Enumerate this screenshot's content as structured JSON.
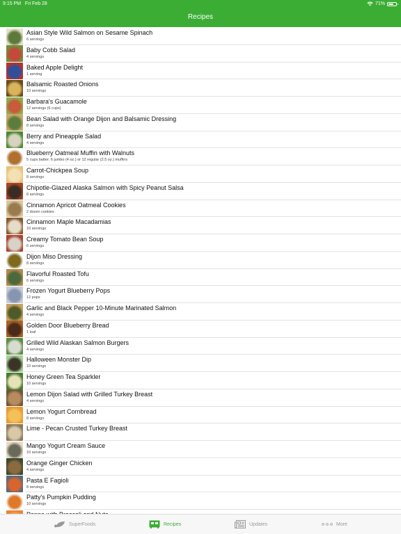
{
  "status_bar": {
    "time": "9:15 PM",
    "date": "Fri Feb 28",
    "battery_percent": "71%",
    "battery_level": 0.71,
    "wifi_icon": "wifi-icon"
  },
  "header": {
    "title": "Recipes"
  },
  "recipes": [
    {
      "name": "Asian Style Wild Salmon on Sesame Spinach",
      "servings": "6 servings",
      "thumb_colors": [
        "#e8e0cf",
        "#5d7a3a"
      ]
    },
    {
      "name": "Baby Cobb Salad",
      "servings": "4 servings",
      "thumb_colors": [
        "#6f8f3c",
        "#c34a3a"
      ]
    },
    {
      "name": "Baked Apple Delight",
      "servings": "1 serving",
      "thumb_colors": [
        "#b8322d",
        "#2f4f9a"
      ]
    },
    {
      "name": "Balsamic Roasted Onions",
      "servings": "10 servings",
      "thumb_colors": [
        "#6b4a1c",
        "#d8b45a"
      ]
    },
    {
      "name": "Barbara's Guacamole",
      "servings": "12 servings (6 cups)",
      "thumb_colors": [
        "#8ab04a",
        "#c95a3a"
      ]
    },
    {
      "name": "Bean Salad with Orange Dijon and Balsamic Dressing",
      "servings": "8 servings",
      "thumb_colors": [
        "#c9a86a",
        "#5b7d3b"
      ]
    },
    {
      "name": "Berry and Pineapple Salad",
      "servings": "4 servings",
      "thumb_colors": [
        "#4d8a2f",
        "#d8d2c0"
      ]
    },
    {
      "name": "Blueberry Oatmeal Muffin with Walnuts",
      "servings": "5 cups batter; 6 jumbo (4 oz.) or 12 regular (2.5 oz.) muffins",
      "thumb_colors": [
        "#ffffff",
        "#b0702e"
      ]
    },
    {
      "name": "Carrot-Chickpea Soup",
      "servings": "8 servings",
      "thumb_colors": [
        "#e9c27a",
        "#f3e0b5"
      ]
    },
    {
      "name": "Chipotle-Glazed Alaska Salmon with Spicy Peanut Salsa",
      "servings": "8 servings",
      "thumb_colors": [
        "#a5442a",
        "#3a2c22"
      ]
    },
    {
      "name": "Cinnamon Apricot Oatmeal Cookies",
      "servings": "2 dozen cookies",
      "thumb_colors": [
        "#d8c7a0",
        "#9a7a4e"
      ]
    },
    {
      "name": "Cinnamon Maple Macadamias",
      "servings": "10 servings",
      "thumb_colors": [
        "#8a5a2e",
        "#e6dcc8"
      ]
    },
    {
      "name": "Creamy Tomato Bean Soup",
      "servings": "6 servings",
      "thumb_colors": [
        "#a9442e",
        "#d9d2c6"
      ]
    },
    {
      "name": "Dijon Miso Dressing",
      "servings": "8 servings",
      "thumb_colors": [
        "#ffffff",
        "#7d6a1e"
      ]
    },
    {
      "name": "Flavorful Roasted Tofu",
      "servings": "6 servings",
      "thumb_colors": [
        "#b4874e",
        "#4a6a3a"
      ]
    },
    {
      "name": "Frozen Yogurt Blueberry Pops",
      "servings": "12 pops",
      "thumb_colors": [
        "#c7ced8",
        "#8696b0"
      ]
    },
    {
      "name": "Garlic and Black Pepper 10-Minute Marinated Salmon",
      "servings": "4 servings",
      "thumb_colors": [
        "#c8a060",
        "#4e5a2a"
      ]
    },
    {
      "name": "Golden Door Blueberry Bread",
      "servings": "1 loaf",
      "thumb_colors": [
        "#a8642a",
        "#4a2a18"
      ]
    },
    {
      "name": "Grilled Wild Alaskan Salmon Burgers",
      "servings": "4 servings",
      "thumb_colors": [
        "#5b8a42",
        "#d8dcd0"
      ]
    },
    {
      "name": "Halloween Monster Dip",
      "servings": "10 servings",
      "thumb_colors": [
        "#a6cf9a",
        "#3a3426"
      ]
    },
    {
      "name": "Honey Green Tea Sparkler",
      "servings": "10 servings",
      "thumb_colors": [
        "#4a7a2e",
        "#e6e2b8"
      ]
    },
    {
      "name": "Lemon Dijon Salad with Grilled Turkey Breast",
      "servings": "4 servings",
      "thumb_colors": [
        "#6a5a3a",
        "#b88a5e"
      ]
    },
    {
      "name": "Lemon Yogurt Cornbread",
      "servings": "8 servings",
      "thumb_colors": [
        "#e89a2e",
        "#f3c05a"
      ]
    },
    {
      "name": "Lime - Pecan Crusted Turkey Breast",
      "servings": "",
      "thumb_colors": [
        "#8a7a5a",
        "#d8c8a8"
      ]
    },
    {
      "name": "Mango Yogurt Cream Sauce",
      "servings": "10 servings",
      "thumb_colors": [
        "#e6dcc8",
        "#6a6a5a"
      ]
    },
    {
      "name": "Orange Ginger Chicken",
      "servings": "4 servings",
      "thumb_colors": [
        "#3a4a2e",
        "#8a6a3e"
      ]
    },
    {
      "name": "Pasta E Fagioli",
      "servings": "8 servings",
      "thumb_colors": [
        "#5a6a7a",
        "#d8642e"
      ]
    },
    {
      "name": "Patty's Pumpkin Pudding",
      "servings": "10 servings",
      "thumb_colors": [
        "#ffffff",
        "#e0782a"
      ]
    },
    {
      "name": "Penne with Broccoli and Nuts",
      "servings": "",
      "thumb_colors": [
        "#e8843a",
        "#f0a85a"
      ]
    }
  ],
  "tabbar": {
    "tabs": [
      {
        "label": "SuperFoods",
        "icon": "leaf-icon",
        "active": false
      },
      {
        "label": "Recipes",
        "icon": "recipes-icon",
        "active": true
      },
      {
        "label": "Updates",
        "icon": "newspaper-icon",
        "active": false
      },
      {
        "label": "More",
        "icon": "more-dots-icon",
        "active": false
      }
    ]
  },
  "colors": {
    "accent": "#3cad34",
    "tab_inactive": "#999999"
  }
}
